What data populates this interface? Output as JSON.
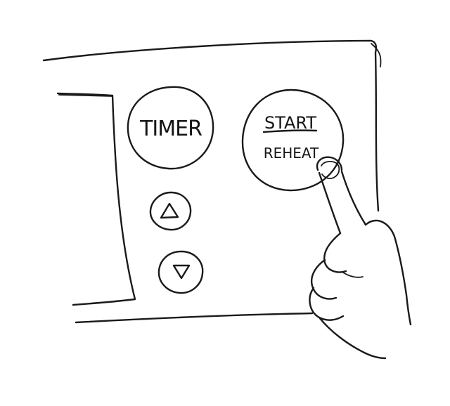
{
  "panel": {
    "timer_button": {
      "label": "TIMER"
    },
    "start_reheat_button": {
      "line1": "START",
      "line2": "REHEAT"
    },
    "up_button": {
      "icon": "triangle-up-icon"
    },
    "down_button": {
      "icon": "triangle-down-icon"
    }
  },
  "colors": {
    "ink": "#1a1a1a",
    "paper": "#ffffff"
  }
}
